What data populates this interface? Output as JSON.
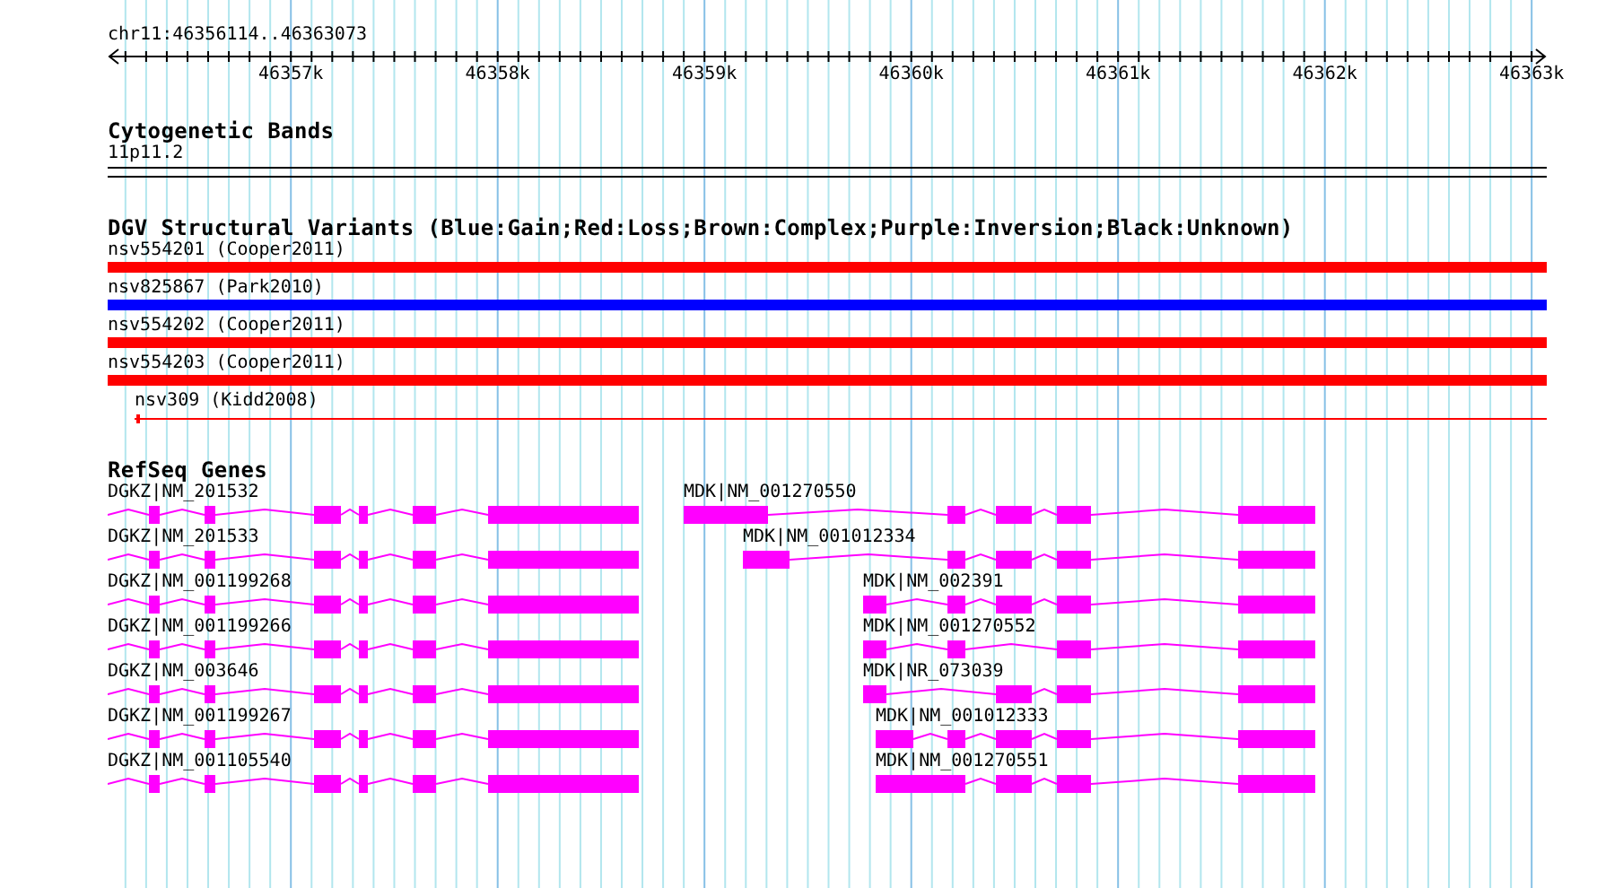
{
  "ruler": {
    "region": "chr11:46356114..46363073",
    "tick_labels": [
      "46357k",
      "46358k",
      "46359k",
      "46360k",
      "46361k",
      "46362k",
      "46363k"
    ]
  },
  "cytogenetic_bands": {
    "title": "Cytogenetic Bands",
    "band": "11p11.2"
  },
  "dgv_structural_variants": {
    "title": "DGV Structural Variants (Blue:Gain;Red:Loss;Brown:Complex;Purple:Inversion;Black:Unknown)",
    "variants": [
      {
        "label": "nsv554201 (Cooper2011)",
        "color": "#ff0000",
        "kind": "bar"
      },
      {
        "label": "nsv825867 (Park2010)",
        "color": "#0000ff",
        "kind": "bar"
      },
      {
        "label": "nsv554202 (Cooper2011)",
        "color": "#ff0000",
        "kind": "bar"
      },
      {
        "label": "nsv554203 (Cooper2011)",
        "color": "#ff0000",
        "kind": "bar"
      },
      {
        "label": "nsv309 (Kidd2008)",
        "color": "#ff0000",
        "kind": "line"
      }
    ]
  },
  "refseq_genes": {
    "title": "RefSeq Genes",
    "rows": [
      {
        "transcripts": [
          {
            "label": "DGKZ|NM_201532"
          },
          {
            "label": "MDK|NM_001270550"
          }
        ]
      },
      {
        "transcripts": [
          {
            "label": "DGKZ|NM_201533"
          },
          {
            "label": "MDK|NM_001012334"
          }
        ]
      },
      {
        "transcripts": [
          {
            "label": "DGKZ|NM_001199268"
          },
          {
            "label": "MDK|NM_002391"
          }
        ]
      },
      {
        "transcripts": [
          {
            "label": "DGKZ|NM_001199266"
          },
          {
            "label": "MDK|NM_001270552"
          }
        ]
      },
      {
        "transcripts": [
          {
            "label": "DGKZ|NM_003646"
          },
          {
            "label": "MDK|NR_073039"
          }
        ]
      },
      {
        "transcripts": [
          {
            "label": "DGKZ|NM_001199267"
          },
          {
            "label": "MDK|NM_001012333"
          }
        ]
      },
      {
        "transcripts": [
          {
            "label": "DGKZ|NM_001105540"
          },
          {
            "label": "MDK|NM_001270551"
          }
        ]
      }
    ]
  }
}
